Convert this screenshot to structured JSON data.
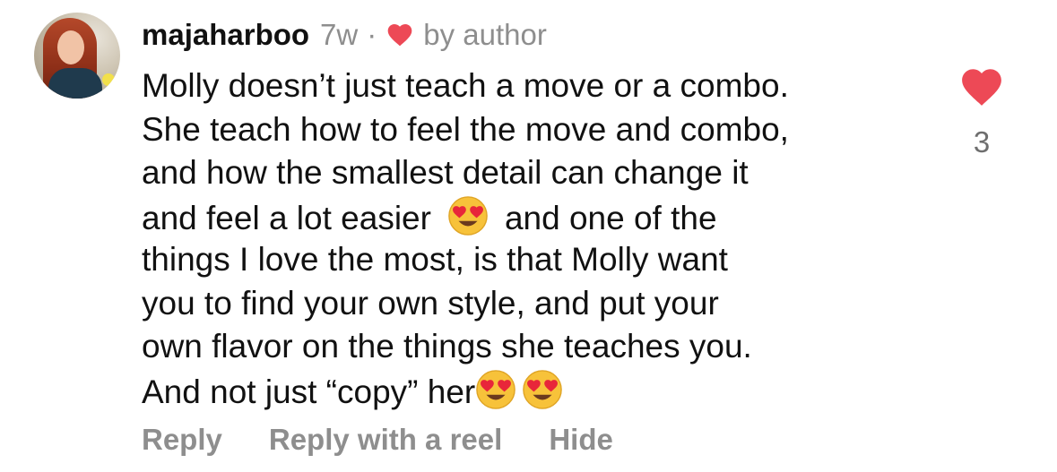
{
  "comment": {
    "username": "majaharboo",
    "time": "7w",
    "separator": "·",
    "liked_by": "by author",
    "lines": [
      "Molly doesn’t just teach a move or a combo.",
      "She teach how to feel the move and combo,",
      "and how the smallest detail can change it",
      "and feel a lot easier",
      "and one of the",
      "things I love the most, is that Molly want",
      "you to find your own style, and put your",
      "own flavor on the things she teaches you.",
      "And not just “copy” her"
    ],
    "like_count": "3"
  },
  "actions": {
    "reply": "Reply",
    "reply_with_reel": "Reply with a reel",
    "hide": "Hide"
  },
  "icons": {
    "avatar": "profile-photo",
    "author_like": "red-heart-icon",
    "emoji": "heart-eyes-emoji",
    "like": "like-heart-icon"
  },
  "colors": {
    "heart": "#ED4956",
    "muted_text": "#8E8E8E",
    "text": "#111111"
  }
}
